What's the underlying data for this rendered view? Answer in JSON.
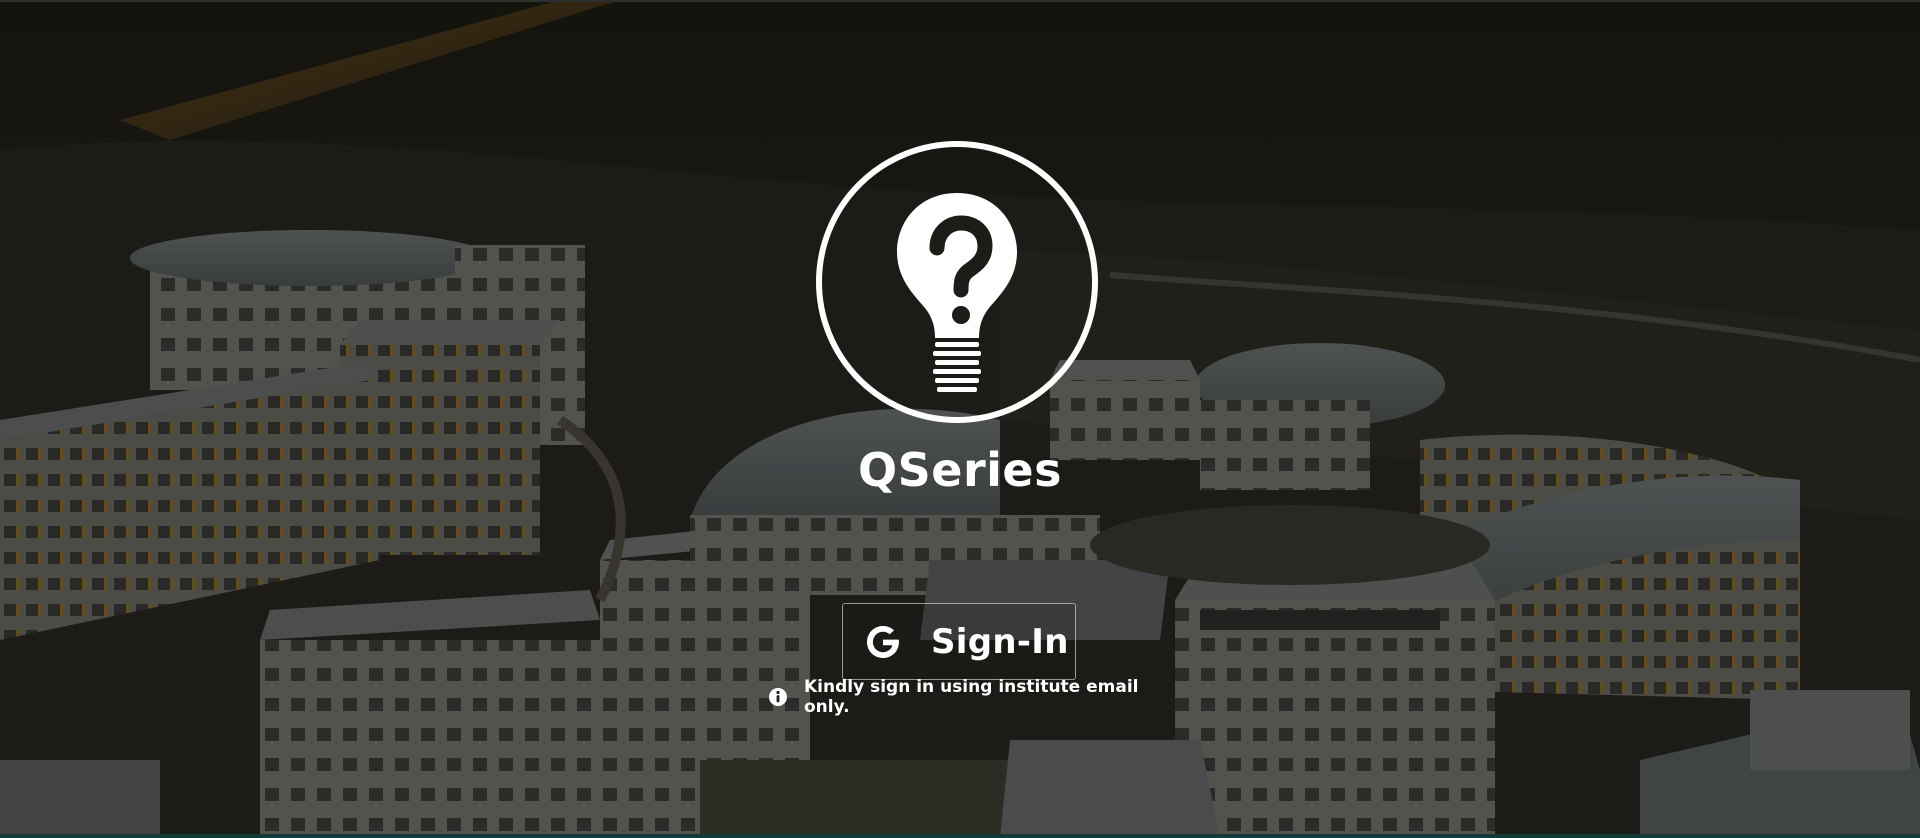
{
  "app": {
    "brand_name": "QSeries"
  },
  "auth": {
    "signin_label": "Sign-In",
    "notice_text": "Kindly sign in using institute email only."
  },
  "icons": {
    "logo": "lightbulb-question-icon",
    "signin": "google-g-icon",
    "notice": "info-circle-icon"
  },
  "colors": {
    "text": "#ffffff",
    "button_border": "#cfcfcf",
    "bottom_strip": "#143b3a"
  }
}
